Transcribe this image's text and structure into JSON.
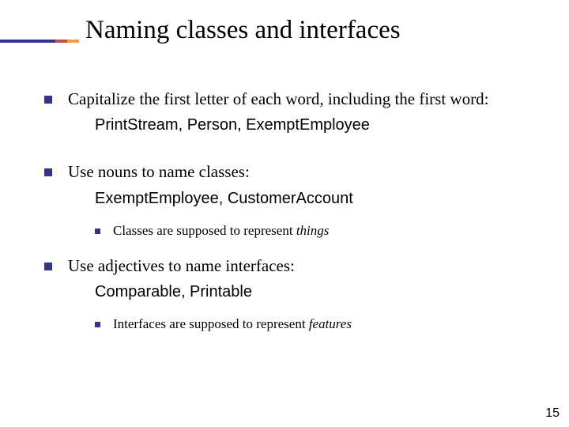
{
  "title": "Naming classes and interfaces",
  "bullets": [
    {
      "text": "Capitalize the first letter of each word, including the first word:",
      "example": "PrintStream, Person, ExemptEmployee"
    },
    {
      "text": "Use nouns to name classes:",
      "example": "ExemptEmployee, CustomerAccount",
      "sub": {
        "lead": "Classes are supposed to represent ",
        "ital": "things"
      }
    },
    {
      "text": "Use adjectives to name interfaces:",
      "example": "Comparable, Printable",
      "sub": {
        "lead": "Interfaces are supposed to represent ",
        "ital": "features"
      }
    }
  ],
  "page_number": "15"
}
